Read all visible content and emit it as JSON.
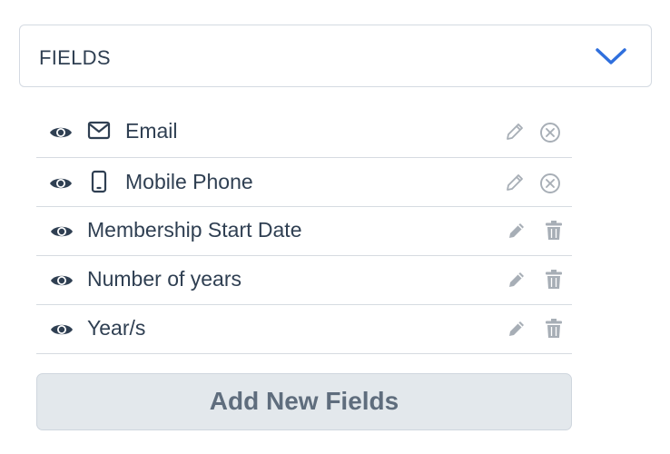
{
  "panel": {
    "title": "FIELDS",
    "toggle_icon": "chevron-down-icon",
    "accent_color": "#2f6fdd"
  },
  "fields": [
    {
      "label": "Email",
      "visibility_icon": "eye-icon",
      "type_icon": "mail-icon",
      "edit_icon": "pencil-outline-icon",
      "remove_icon": "circle-x-icon"
    },
    {
      "label": "Mobile Phone",
      "visibility_icon": "eye-icon",
      "type_icon": "mobile-phone-icon",
      "edit_icon": "pencil-outline-icon",
      "remove_icon": "circle-x-icon"
    },
    {
      "label": "Membership Start Date",
      "visibility_icon": "eye-icon",
      "edit_icon": "pencil-icon",
      "remove_icon": "trash-icon"
    },
    {
      "label": "Number of years",
      "visibility_icon": "eye-icon",
      "edit_icon": "pencil-icon",
      "remove_icon": "trash-icon"
    },
    {
      "label": "Year/s",
      "visibility_icon": "eye-icon",
      "edit_icon": "pencil-icon",
      "remove_icon": "trash-icon"
    }
  ],
  "add_button": {
    "label": "Add New Fields"
  },
  "colors": {
    "text": "#2f3f52",
    "icon_muted": "#a7aeb6",
    "button_bg": "#e3e8ec",
    "button_text": "#5f6d7d",
    "divider": "#d6dbe1"
  }
}
